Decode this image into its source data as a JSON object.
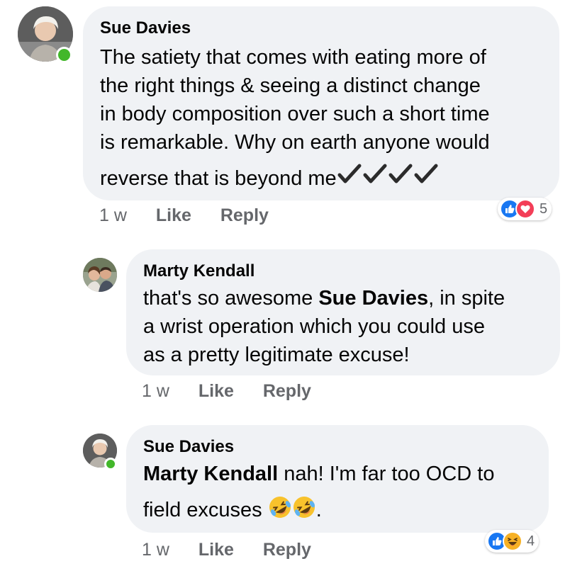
{
  "comments": [
    {
      "author": "Sue Davies",
      "lines": [
        "The satiety that comes with eating more of",
        "the right things & seeing a distinct change",
        "in body composition over such a short time",
        "is remarkable. Why on earth anyone would",
        "reverse that is beyond me"
      ],
      "trailing_icons": [
        "heavy-check-mark-icon",
        "heavy-check-mark-icon",
        "heavy-check-mark-icon",
        "heavy-check-mark-icon"
      ],
      "time": "1 w",
      "like_label": "Like",
      "reply_label": "Reply",
      "reactions": [
        "like-icon",
        "love-icon"
      ],
      "reaction_count": "5"
    },
    {
      "author": "Marty Kendall",
      "line1_prefix": "that's so awesome ",
      "line1_mention": "Sue Davies",
      "line1_suffix": ", in spite",
      "line2": "a wrist operation which you could use",
      "line3": "as a pretty legitimate excuse!",
      "time": "1 w",
      "like_label": "Like",
      "reply_label": "Reply"
    },
    {
      "author": "Sue Davies",
      "mention": "Marty Kendall",
      "line1_suffix": " nah! I'm far too OCD to",
      "line2": "field excuses",
      "line2_end": ".",
      "emoji": [
        "rolling-on-floor-laughing-icon",
        "rolling-on-floor-laughing-icon"
      ],
      "time": "1 w",
      "like_label": "Like",
      "reply_label": "Reply",
      "reactions": [
        "like-icon",
        "laughing-icon"
      ],
      "reaction_count": "4"
    }
  ],
  "colors": {
    "bubble": "#f0f2f5",
    "meta": "#65676b",
    "like": "#1877f2",
    "love": "#f33e58",
    "haha": "#f7b125",
    "online": "#42b72a"
  }
}
